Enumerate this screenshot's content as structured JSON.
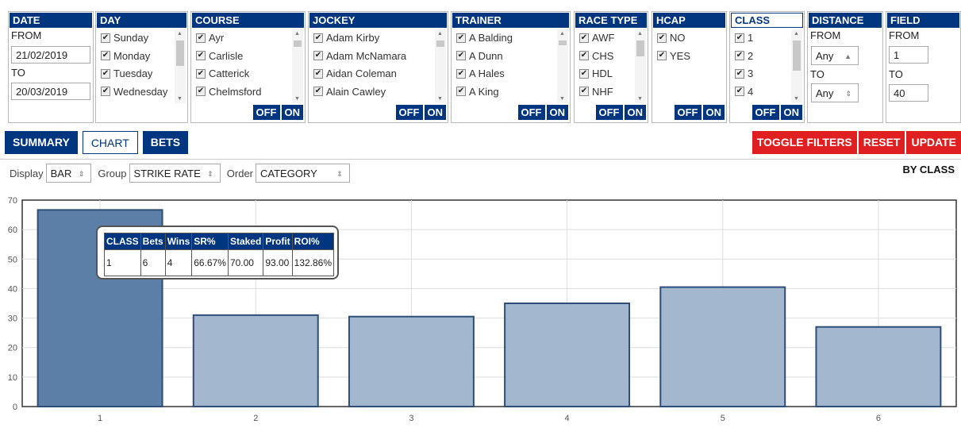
{
  "filters": {
    "date": {
      "title": "DATE",
      "from_label": "FROM",
      "from_value": "21/02/2019",
      "to_label": "TO",
      "to_value": "20/03/2019"
    },
    "day": {
      "title": "DAY",
      "items": [
        "Sunday",
        "Monday",
        "Tuesday",
        "Wednesday"
      ]
    },
    "course": {
      "title": "COURSE",
      "items": [
        "Ayr",
        "Carlisle",
        "Catterick",
        "Chelmsford"
      ]
    },
    "jockey": {
      "title": "JOCKEY",
      "items": [
        "Adam Kirby",
        "Adam McNamara",
        "Aidan Coleman",
        "Alain Cawley"
      ]
    },
    "trainer": {
      "title": "TRAINER",
      "items": [
        "A Balding",
        "A Dunn",
        "A Hales",
        "A King"
      ]
    },
    "race_type": {
      "title": "RACE TYPE",
      "items": [
        "AWF",
        "CHS",
        "HDL",
        "NHF"
      ]
    },
    "hcap": {
      "title": "HCAP",
      "items": [
        "NO",
        "YES"
      ]
    },
    "class": {
      "title": "CLASS",
      "items": [
        "1",
        "2",
        "3",
        "4"
      ]
    },
    "distance": {
      "title": "DISTANCE",
      "from_label": "FROM",
      "from_value": "Any",
      "to_label": "TO",
      "to_value": "Any"
    },
    "field": {
      "title": "FIELD",
      "from_label": "FROM",
      "from_value": "1",
      "to_label": "TO",
      "to_value": "40"
    },
    "off_label": "OFF",
    "on_label": "ON"
  },
  "tabs": {
    "summary": "SUMMARY",
    "chart": "CHART",
    "bets": "BETS"
  },
  "actions": {
    "toggle_filters": "TOGGLE FILTERS",
    "reset": "RESET",
    "update": "UPDATE"
  },
  "options": {
    "display_label": "Display",
    "display_value": "BAR",
    "group_label": "Group",
    "group_value": "STRIKE RATE",
    "order_label": "Order",
    "order_value": "CATEGORY"
  },
  "chart_title": "BY CLASS",
  "tooltip": {
    "headers": [
      "CLASS",
      "Bets",
      "Wins",
      "SR%",
      "Staked",
      "Profit",
      "ROI%"
    ],
    "row": [
      "1",
      "6",
      "4",
      "66.67%",
      "70.00",
      "93.00",
      "132.86%"
    ]
  },
  "colors": {
    "brand": "#003580",
    "danger": "#e02020",
    "bar": "#a3b8cf",
    "bar_active": "#5b7fa6",
    "bar_border": "#2c4e78"
  },
  "chart_data": {
    "type": "bar",
    "categories": [
      "1",
      "2",
      "3",
      "4",
      "5",
      "6"
    ],
    "values": [
      66.67,
      31,
      30.5,
      35,
      40.5,
      27
    ],
    "highlighted_index": 0,
    "ylim": [
      0,
      70
    ],
    "yticks": [
      0,
      10,
      20,
      30,
      40,
      50,
      60,
      70
    ],
    "grid": true
  }
}
